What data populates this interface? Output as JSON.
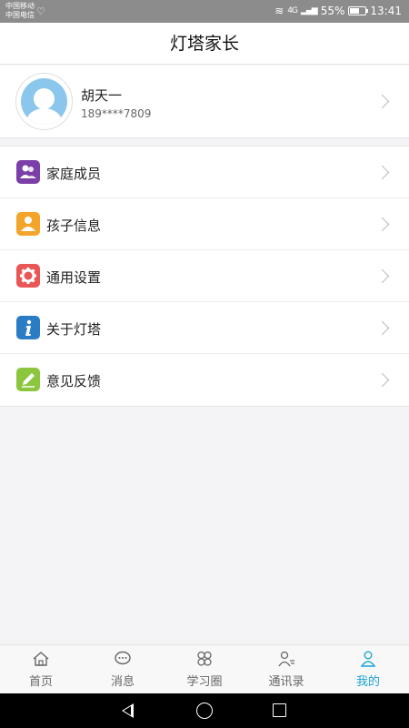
{
  "status_bar": {
    "carrier_1": "中国移动",
    "carrier_2": "中国电信",
    "network": "4G",
    "battery": "55%",
    "time": "13:41"
  },
  "header": {
    "title": "灯塔家长"
  },
  "profile": {
    "name": "胡天一",
    "phone": "189****7809"
  },
  "menu": {
    "items": [
      {
        "label": "家庭成员",
        "icon": "family-icon",
        "color": "#7b3fa8"
      },
      {
        "label": "孩子信息",
        "icon": "child-info-icon",
        "color": "#f2a52a"
      },
      {
        "label": "通用设置",
        "icon": "gear-icon",
        "color": "#e85656"
      },
      {
        "label": "关于灯塔",
        "icon": "info-icon",
        "color": "#2a7cc4"
      },
      {
        "label": "意见反馈",
        "icon": "pencil-icon",
        "color": "#8cc63f"
      }
    ]
  },
  "tabbar": {
    "tabs": [
      {
        "label": "首页",
        "icon": "home-icon"
      },
      {
        "label": "消息",
        "icon": "message-icon"
      },
      {
        "label": "学习圈",
        "icon": "clover-icon"
      },
      {
        "label": "通讯录",
        "icon": "contacts-icon"
      },
      {
        "label": "我的",
        "icon": "person-icon",
        "active": true
      }
    ],
    "active_color": "#1aa3d4"
  }
}
